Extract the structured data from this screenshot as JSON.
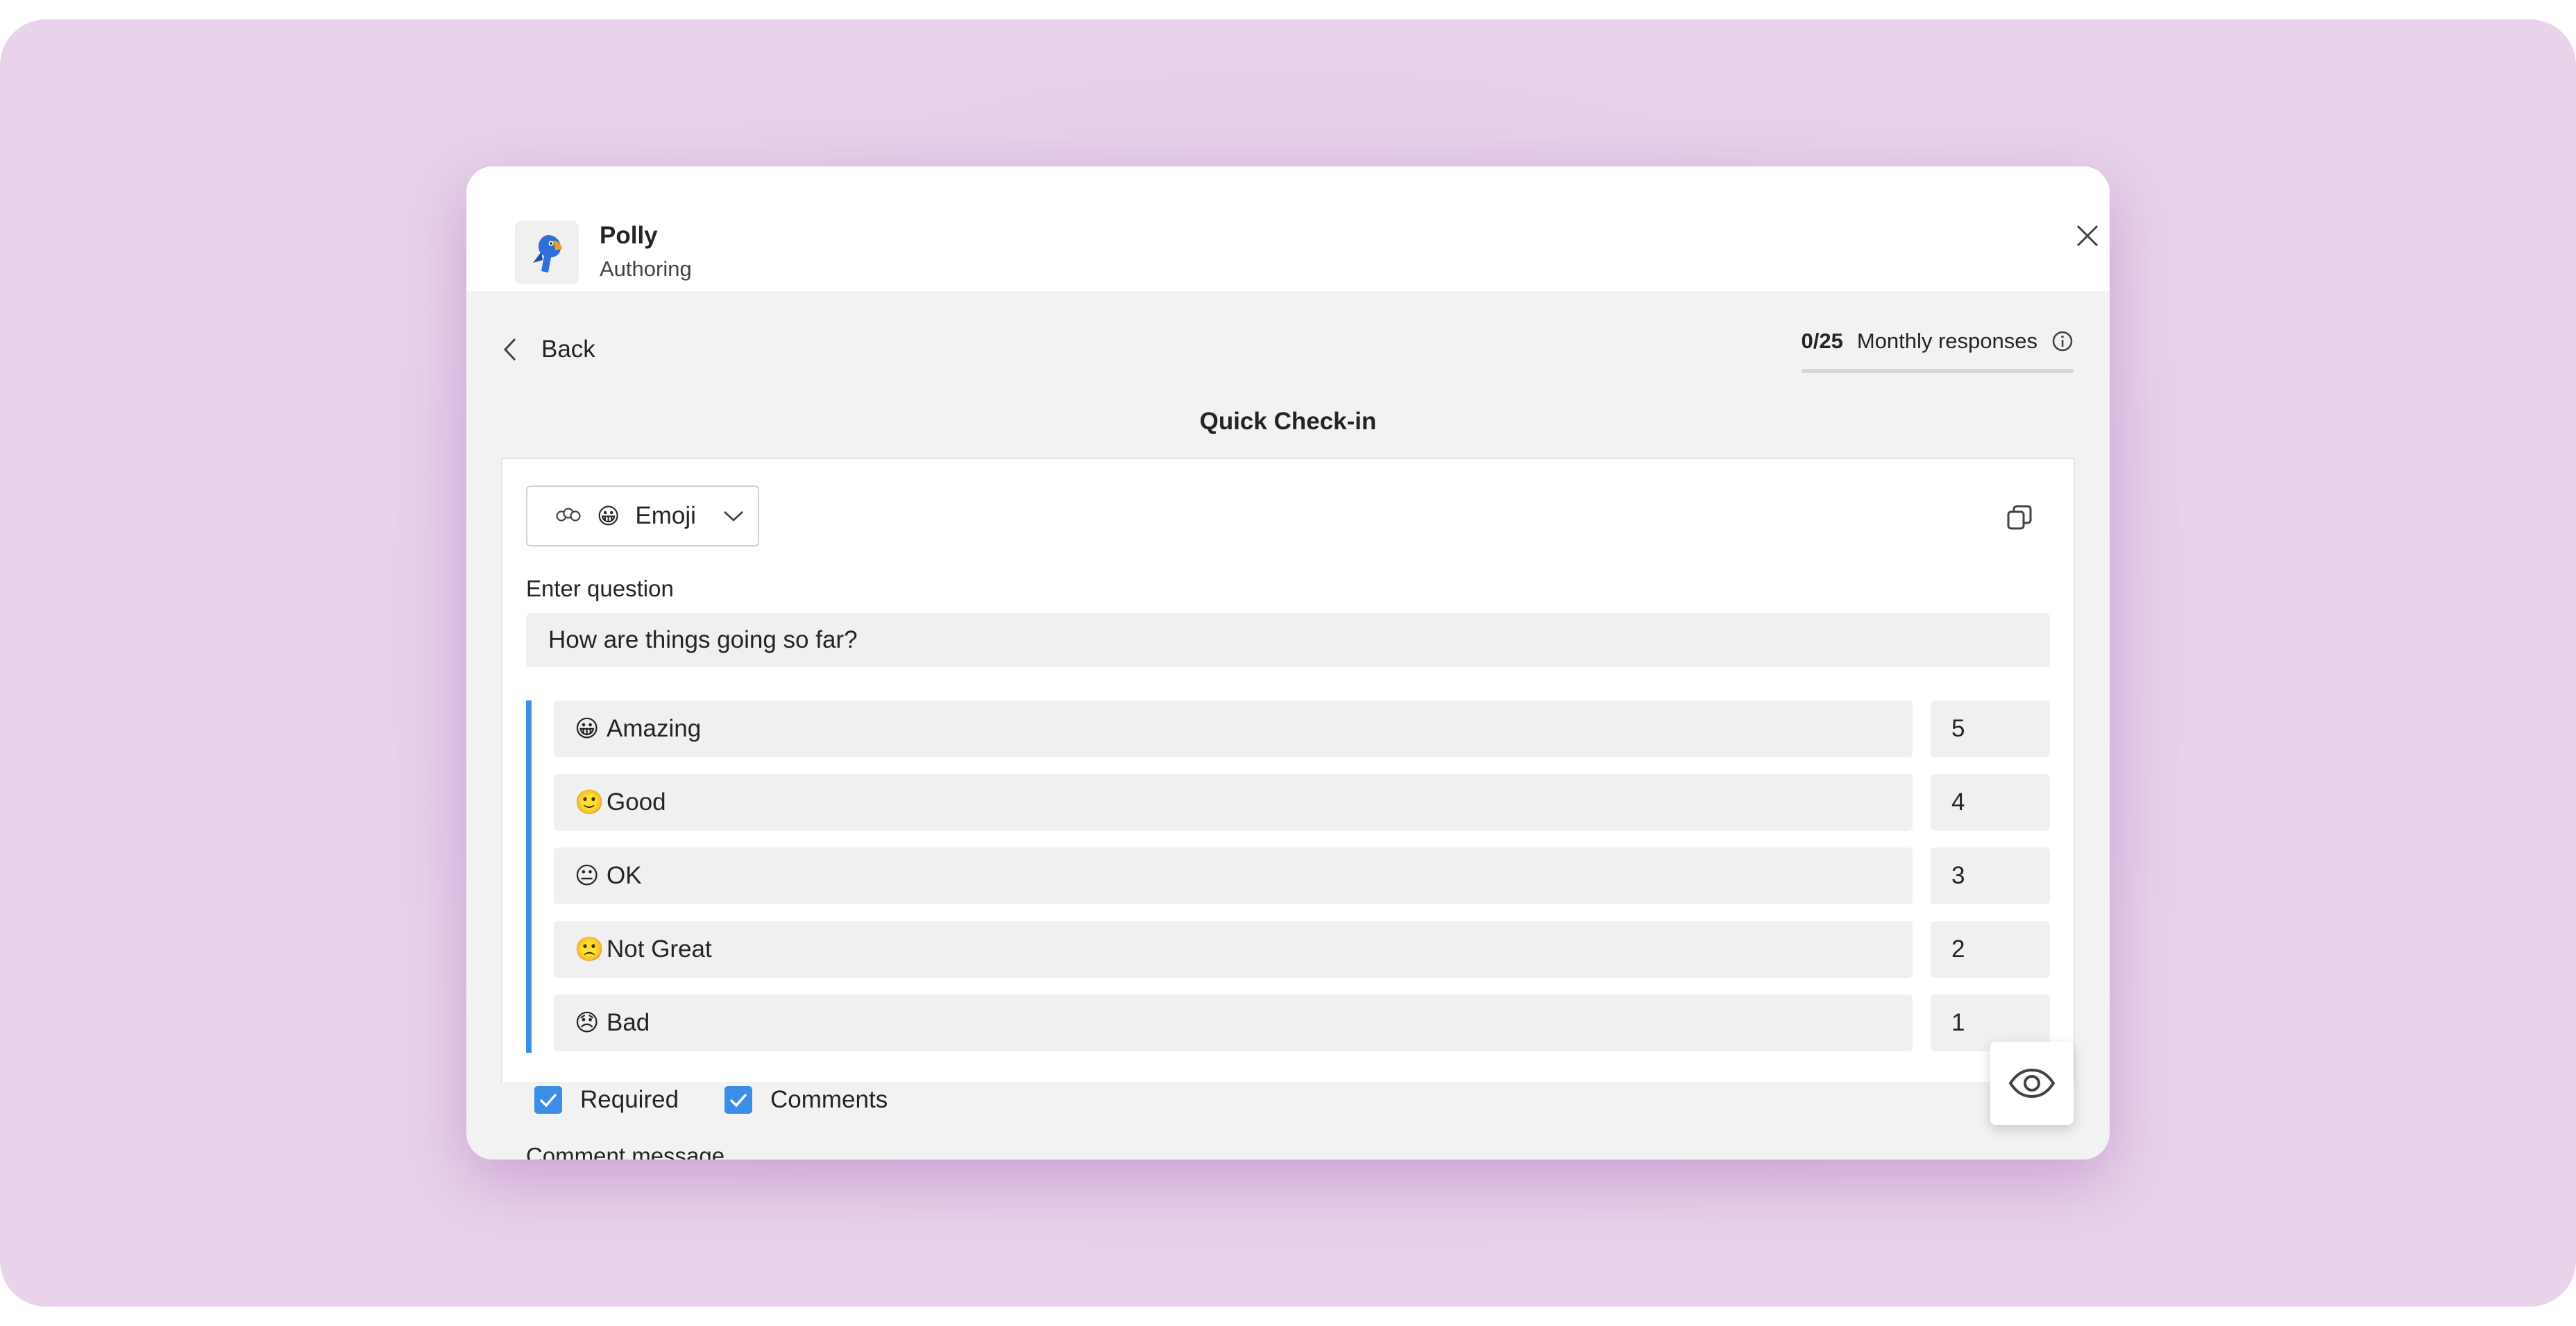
{
  "app": {
    "name": "Polly",
    "subtitle": "Authoring"
  },
  "nav": {
    "back_label": "Back"
  },
  "responses": {
    "count": "0/25",
    "label": "Monthly responses",
    "progress": 0
  },
  "page": {
    "title": "Quick Check-in"
  },
  "question_type": {
    "icon": "emoji-icon",
    "selected": "Emoji"
  },
  "question": {
    "label": "Enter question",
    "value": "How are things going so far?"
  },
  "options": [
    {
      "emoji": "😀",
      "label": "Amazing",
      "score": "5"
    },
    {
      "emoji": "🙂",
      "label": "Good",
      "score": "4"
    },
    {
      "emoji": "😐",
      "label": "OK",
      "score": "3"
    },
    {
      "emoji": "🙁",
      "label": "Not Great",
      "score": "2"
    },
    {
      "emoji": "😞",
      "label": "Bad",
      "score": "1"
    }
  ],
  "settings": {
    "required": {
      "label": "Required",
      "checked": true
    },
    "comments": {
      "label": "Comments",
      "checked": true
    }
  },
  "comment_message_label": "Comment message",
  "colors": {
    "accent": "#3a8ee6",
    "backdrop": "#d9b6e2"
  }
}
